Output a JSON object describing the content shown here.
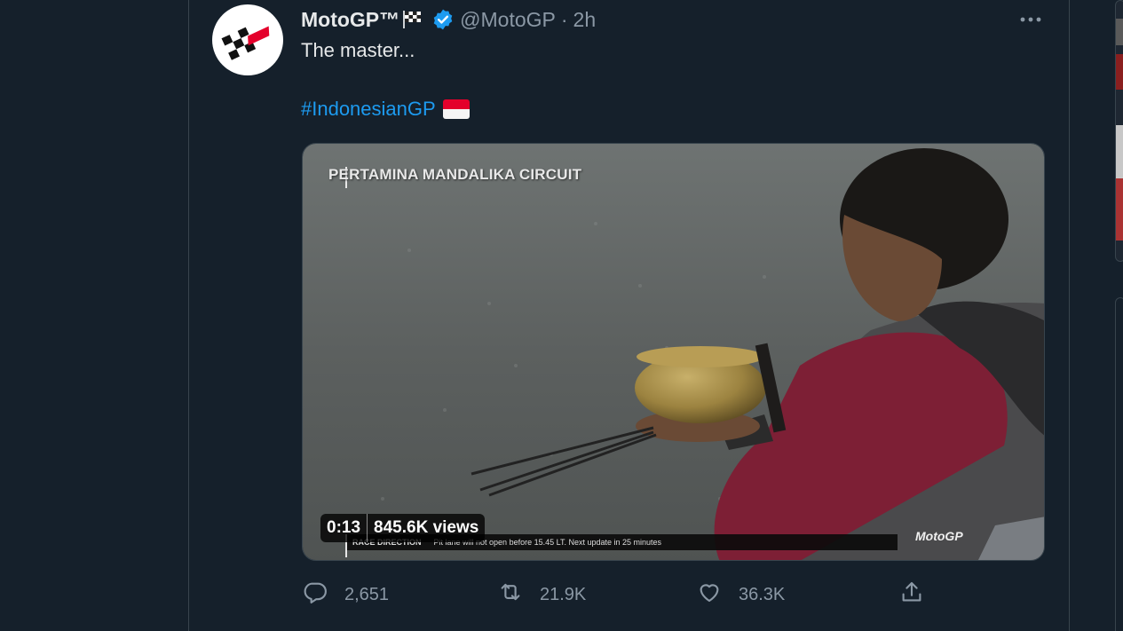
{
  "tweet": {
    "author_name": "MotoGP™",
    "handle": "@MotoGP",
    "separator": "·",
    "time": "2h",
    "text": "The master...",
    "hashtag": "#IndonesianGP",
    "avatar_logo_text": "motogp",
    "flag_emoji": "Indonesia flag"
  },
  "media": {
    "caption": "PERTAMINA MANDALIKA CIRCUIT",
    "duration": "0:13",
    "views": "845.6K views",
    "ticker_label": "RACE DIRECTION",
    "ticker_text": "Pit lane will not open before 15.45 LT. Next update in 25 minutes",
    "watermark": "MotoGP"
  },
  "actions": {
    "replies": "2,651",
    "retweets": "21.9K",
    "likes": "36.3K"
  },
  "icons": {
    "verified": "verified-badge-icon",
    "more": "more-options-icon",
    "reply": "reply-icon",
    "retweet": "retweet-icon",
    "like": "heart-icon",
    "share": "share-icon",
    "chequered_flag": "chequered-flag-icon"
  },
  "colors": {
    "background": "#15202b",
    "link": "#1d9bf0",
    "muted": "#8b98a5",
    "verified": "#1d9bf0",
    "brand_red": "#e4002b"
  }
}
